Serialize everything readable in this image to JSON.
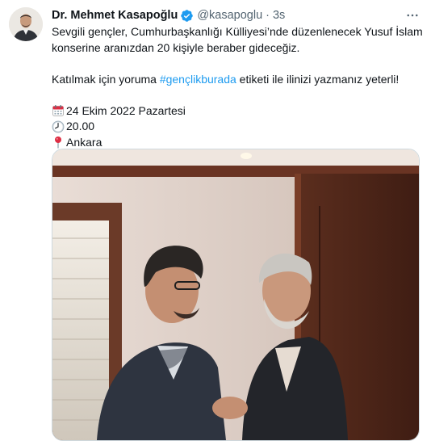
{
  "author": {
    "display_name": "Dr. Mehmet Kasapoğlu",
    "handle": "@kasapoglu",
    "separator": "·",
    "time": "3s"
  },
  "body": {
    "paragraph1": "Sevgili gençler, Cumhurbaşkanlığı Külliyesi’nde düzenlenecek Yusuf İslam konserine aranızdan 20 kişiyle beraber gideceğiz.",
    "p2_before": "Katılmak için yoruma ",
    "hashtag": "#gençlikburada",
    "p2_after": " etiketi ile ilinizi yazmanız yeterli!",
    "date": "24 Ekim 2022 Pazartesi",
    "time": "20.00",
    "place": "Ankara"
  },
  "icons": {
    "verified": "verified-badge-icon",
    "more": "more-options-icon",
    "calendar": "calendar-icon",
    "clock": "clock-icon",
    "pin": "location-pin-icon"
  },
  "colors": {
    "accent": "#1d9bf0",
    "text": "#0f1419",
    "muted": "#536471"
  }
}
